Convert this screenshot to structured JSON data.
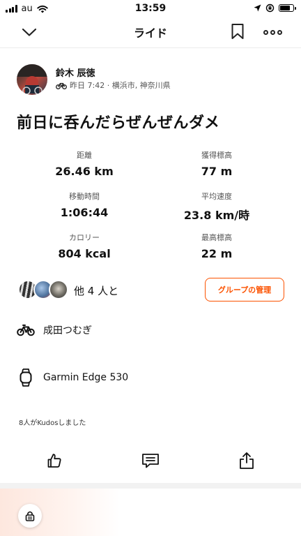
{
  "status_bar": {
    "carrier": "au",
    "time": "13:59",
    "battery_level": 0.75
  },
  "nav": {
    "title": "ライド"
  },
  "athlete": {
    "name": "鈴木 辰徳",
    "meta": "昨日 7:42 · 横浜市, 神奈川県"
  },
  "activity": {
    "title": "前日に呑んだらぜんぜんダメ"
  },
  "stats": [
    {
      "label": "距離",
      "value": "26.46 km"
    },
    {
      "label": "獲得標高",
      "value": "77 m"
    },
    {
      "label": "移動時間",
      "value": "1:06:44"
    },
    {
      "label": "平均速度",
      "value": "23.8 km/時"
    },
    {
      "label": "カロリー",
      "value": "804 kcal"
    },
    {
      "label": "最高標高",
      "value": "22 m"
    }
  ],
  "group": {
    "label": "他 4 人と",
    "manage_button": "グループの管理"
  },
  "bike": {
    "name": "成田つむぎ"
  },
  "device": {
    "name": "Garmin Edge 530"
  },
  "kudos": {
    "text": "8人がKudosしました"
  },
  "colors": {
    "accent": "#fc5200",
    "text": "#111111",
    "muted": "#555555"
  },
  "icons": {
    "back": "chevron-down-icon",
    "bookmark": "bookmark-icon",
    "more": "more-icon",
    "bike": "bike-icon",
    "watch": "watch-icon",
    "kudos": "thumbs-up-icon",
    "comment": "comment-icon",
    "share": "share-icon",
    "lock": "lock-icon"
  }
}
